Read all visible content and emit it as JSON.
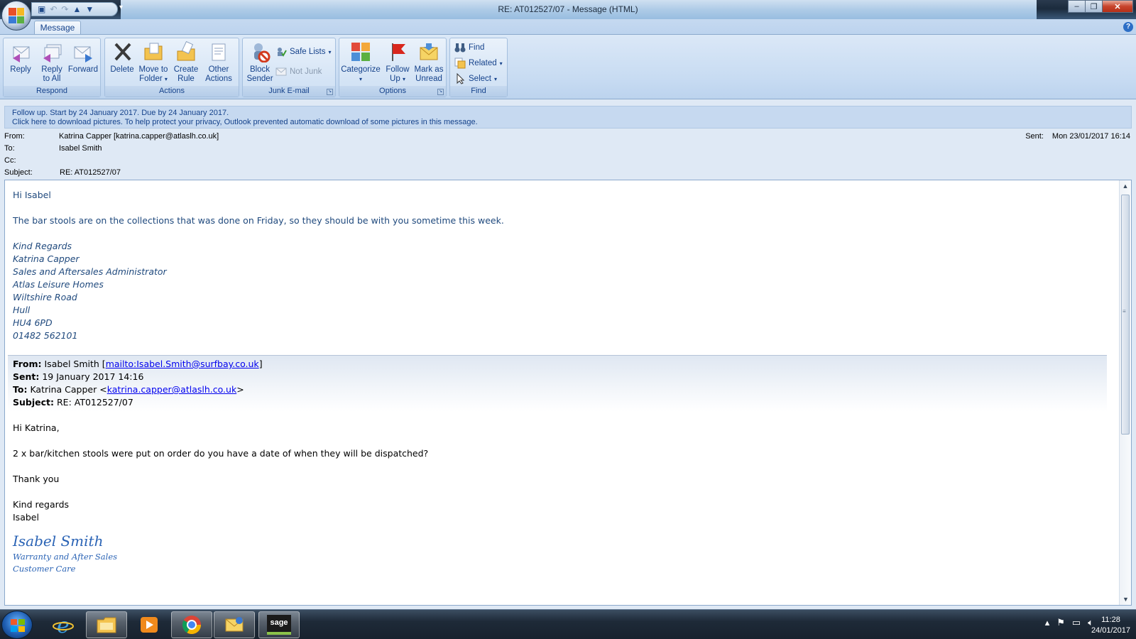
{
  "window": {
    "title": "RE: AT012527/07 - Message (HTML)",
    "controls": [
      "minimize",
      "restore",
      "close"
    ]
  },
  "quick_access": {
    "icons": [
      "save-icon",
      "undo-icon",
      "redo-icon",
      "previous-icon",
      "next-icon"
    ],
    "more": "▾"
  },
  "ribbon": {
    "tab": "Message",
    "groups": {
      "respond": {
        "label": "Respond",
        "reply": "Reply",
        "reply_all_1": "Reply",
        "reply_all_2": "to All",
        "forward": "Forward"
      },
      "actions": {
        "label": "Actions",
        "delete": "Delete",
        "move_1": "Move to",
        "move_2": "Folder",
        "rule_1": "Create",
        "rule_2": "Rule",
        "other_1": "Other",
        "other_2": "Actions"
      },
      "junk": {
        "label": "Junk E-mail",
        "block_1": "Block",
        "block_2": "Sender",
        "safe_lists": "Safe Lists",
        "not_junk": "Not Junk"
      },
      "options": {
        "label": "Options",
        "categorize": "Categorize",
        "follow_1": "Follow",
        "follow_2": "Up",
        "mark_1": "Mark as",
        "mark_2": "Unread"
      },
      "find": {
        "label": "Find",
        "find": "Find",
        "related": "Related",
        "select": "Select"
      }
    }
  },
  "infobar": {
    "line1": "Follow up.  Start by 24 January 2017.  Due by 24 January 2017.",
    "line2": "Click here to download pictures. To help protect your privacy, Outlook prevented automatic download of some pictures in this message."
  },
  "headers": {
    "from_label": "From:",
    "from": "Katrina Capper [katrina.capper@atlaslh.co.uk]",
    "to_label": "To:",
    "to": "Isabel Smith",
    "cc_label": "Cc:",
    "cc": "",
    "subject_label": "Subject:",
    "subject": "RE: AT012527/07",
    "sent_label": "Sent:",
    "sent": "Mon 23/01/2017 16:14"
  },
  "message": {
    "greeting": "Hi Isabel",
    "body": "The bar stools are on the collections that was done on Friday, so they should be with you sometime this week.",
    "signature": [
      "Kind Regards",
      "Katrina Capper",
      "Sales and Aftersales Administrator",
      "Atlas Leisure Homes",
      "Wiltshire Road",
      "Hull",
      "HU4 6PD",
      "01482 562101"
    ],
    "quoted": {
      "from_label": "From:",
      "from_name": "Isabel Smith [",
      "from_link": "mailto:Isabel.Smith@surfbay.co.uk",
      "from_end": "]",
      "sent_label": "Sent:",
      "sent": "19 January 2017 14:16",
      "to_label": "To:",
      "to_name": "Katrina Capper <",
      "to_link": "katrina.capper@atlaslh.co.uk",
      "to_end": ">",
      "subject_label": "Subject:",
      "subject": "RE: AT012527/07",
      "greeting": "Hi Katrina,",
      "body": "2 x bar/kitchen stools were put on order do you have a date of when they will be dispatched?",
      "thanks": "Thank you",
      "regards": "Kind regards",
      "name": "Isabel",
      "sig_name": "Isabel Smith",
      "sig_line1": "Warranty and After Sales",
      "sig_line2": "Customer Care"
    }
  },
  "taskbar": {
    "apps": [
      "start-button",
      "internet-explorer",
      "file-explorer",
      "media-player",
      "chrome",
      "outlook",
      "sage"
    ],
    "sage_label": "sage",
    "time": "11:28",
    "date": "24/01/2017"
  },
  "colors": {
    "ribbon": "#c7dbf2",
    "accent": "#15428b",
    "message_blue": "#1f497d",
    "link": "#0000ee"
  }
}
